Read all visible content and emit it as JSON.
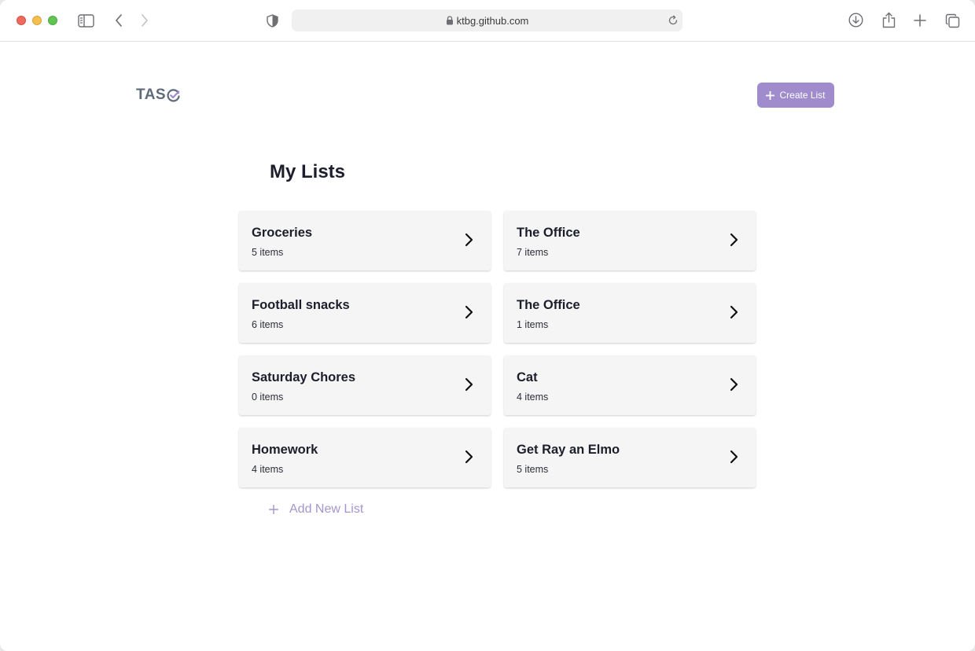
{
  "browser": {
    "url": "ktbg.github.com"
  },
  "app": {
    "logo_text": "TAS",
    "create_button_label": "Create List",
    "page_title": "My Lists",
    "add_new_label": "Add New List"
  },
  "lists": [
    {
      "name": "Groceries",
      "count": "5 items"
    },
    {
      "name": "The Office",
      "count": "7 items"
    },
    {
      "name": "Football snacks",
      "count": "6 items"
    },
    {
      "name": "The Office",
      "count": "1 items"
    },
    {
      "name": "Saturday Chores",
      "count": "0 items"
    },
    {
      "name": "Cat",
      "count": "4 items"
    },
    {
      "name": "Homework",
      "count": "4 items"
    },
    {
      "name": "Get Ray an Elmo",
      "count": "5 items"
    }
  ],
  "colors": {
    "accent": "#a08ccc",
    "accent_text": "#a596cf",
    "card_bg": "#f5f5f5",
    "title": "#1c1f2b"
  },
  "icons": {
    "sidebar": "sidebar-icon",
    "back": "chevron-left-icon",
    "forward": "chevron-right-icon",
    "shield": "shield-icon",
    "lock": "lock-icon",
    "reload": "reload-icon",
    "download": "download-icon",
    "share": "share-icon",
    "new_tab": "plus-icon",
    "tabs": "tabs-overview-icon",
    "card_chevron": "chevron-right-icon",
    "logo_check": "check-circle-icon"
  }
}
